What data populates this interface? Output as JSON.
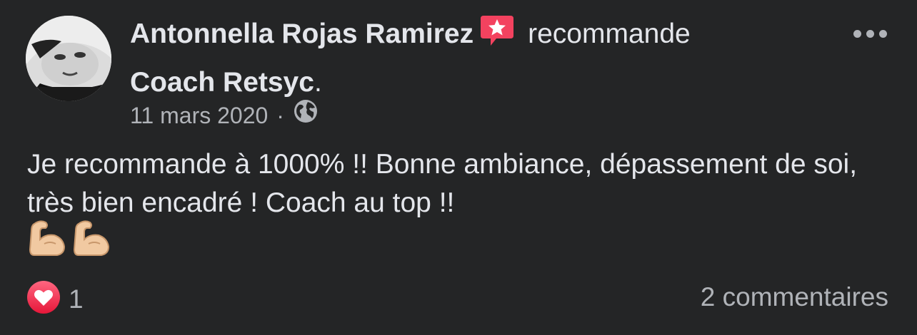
{
  "post": {
    "author": "Antonnella Rojas Ramirez",
    "verb": "recommande",
    "page": "Coach Retsyc",
    "page_suffix": ".",
    "date": "11 mars 2020",
    "separator": "·",
    "privacy_icon": "globe-icon",
    "badge_icon": "recommendation-star-icon",
    "badge_color": "#f3425f",
    "text": "Je recommande à 1000% !! Bonne ambiance, dépassement de soi, très bien encadré ! Coach au top !!",
    "emojis": [
      "flexed-biceps-icon",
      "flexed-biceps-icon"
    ]
  },
  "reactions": {
    "icon": "heart-reaction-icon",
    "color": "#f33e58",
    "count": "1"
  },
  "comments": {
    "label": "2 commentaires"
  },
  "menu": {
    "icon": "more-options-icon"
  }
}
